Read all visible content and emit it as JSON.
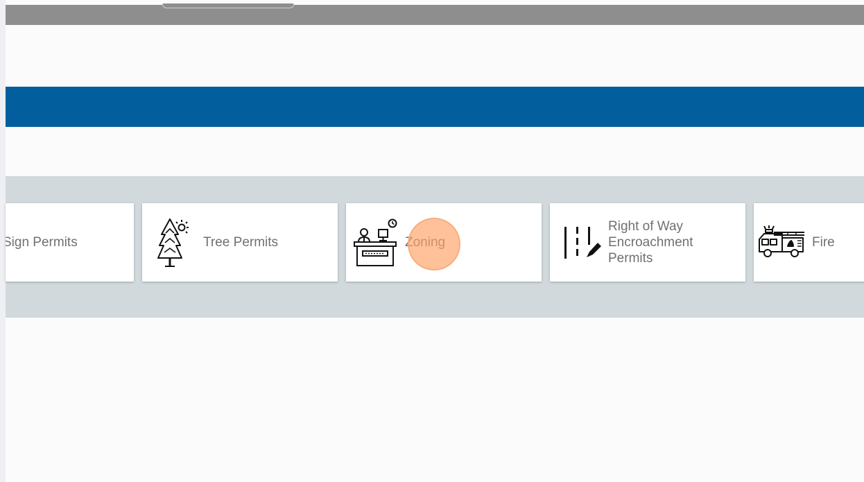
{
  "tiles": {
    "sign": {
      "label": "Sign Permits",
      "icon": "sign-icon"
    },
    "tree": {
      "label": "Tree Permits",
      "icon": "tree-sun-icon"
    },
    "zoning": {
      "label": "Zoning",
      "icon": "zoning-desk-icon"
    },
    "right_of_way": {
      "label": "Right of Way\nEncroachment\nPermits",
      "icon": "road-lines-pencil-icon"
    },
    "fire": {
      "label": "Fire",
      "icon": "fire-truck-icon"
    }
  },
  "colors": {
    "top_bar": "#8e8e8e",
    "nav_band": "#025e9d",
    "tiles_band": "#d1d9dd",
    "label_text": "#707070",
    "click_marker": "#ffa064"
  }
}
